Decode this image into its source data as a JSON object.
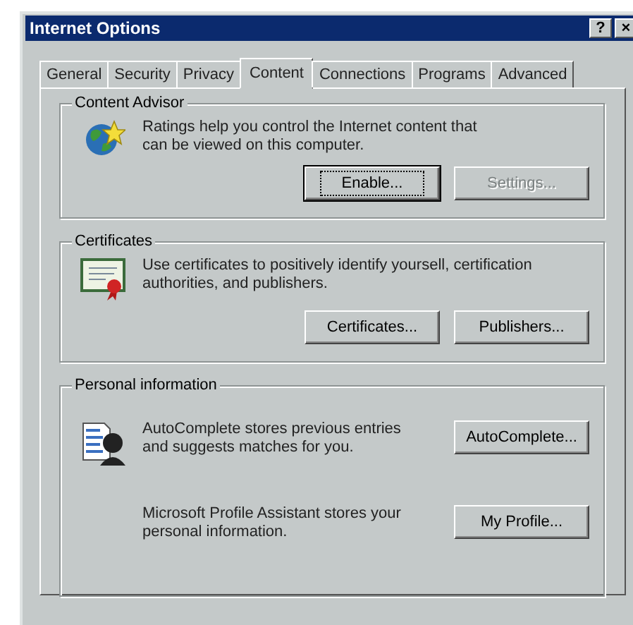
{
  "window": {
    "title": "Internet Options",
    "title_buttons": [
      "?",
      "×"
    ]
  },
  "tabs": [
    {
      "label": "General",
      "selected": false
    },
    {
      "label": "Security",
      "selected": false
    },
    {
      "label": "Privacy",
      "selected": false
    },
    {
      "label": "Content",
      "selected": true
    },
    {
      "label": "Connections",
      "selected": false
    },
    {
      "label": "Programs",
      "selected": false
    },
    {
      "label": "Advanced",
      "selected": false
    }
  ],
  "groups": [
    {
      "title": "Content Advisor",
      "rows": [
        {
          "kind": "globe",
          "text": "Ratings help you control the Internet content that can be viewed on this computer.",
          "buttons": [
            {
              "label": "Enable...",
              "disabled": false,
              "focused": true
            },
            {
              "label": "Settings...",
              "disabled": true,
              "focused": false
            }
          ]
        }
      ]
    },
    {
      "title": "Certificates",
      "rows": [
        {
          "kind": "certificate",
          "text": "Use certificates to positively identify yoursell, certification authorities, and publishers.",
          "buttons": [
            {
              "label": "Certificates...",
              "disabled": false,
              "focused": false
            },
            {
              "label": "Publishers...",
              "disabled": false,
              "focused": false
            }
          ]
        }
      ]
    },
    {
      "title": "Personal information",
      "rows": [
        {
          "kind": "autocomplete",
          "text": "AutoComplete stores previous entries and suggests matches for you.",
          "buttons": [
            {
              "label": "AutoComplete...",
              "disabled": false,
              "focused": false
            }
          ]
        },
        {
          "kind": "plain",
          "text": "Microsoft Profile Assistant stores your personal information.",
          "buttons": [
            {
              "label": "My Profile...",
              "disabled": false,
              "focused": false
            }
          ]
        }
      ]
    }
  ]
}
